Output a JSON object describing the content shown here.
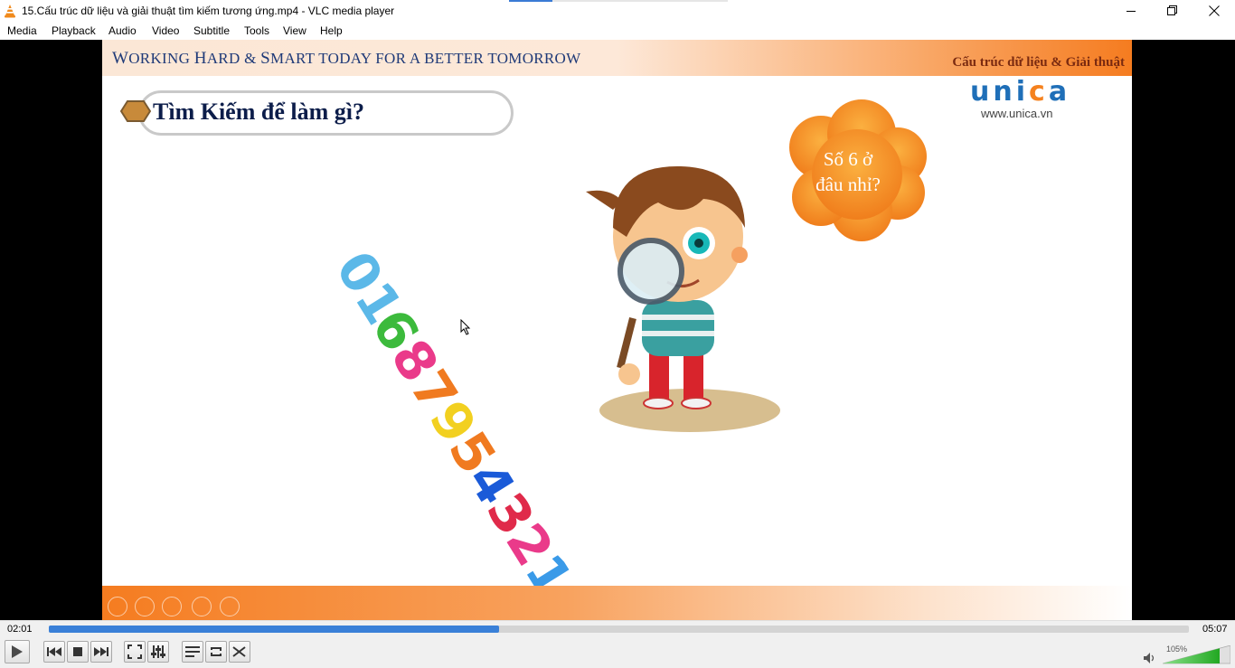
{
  "window": {
    "title": "15.Cấu trúc dữ liệu và giải thuật tìm kiếm tương ứng.mp4 - VLC media player"
  },
  "menu": {
    "media": "Media",
    "playback": "Playback",
    "audio": "Audio",
    "video": "Video",
    "subtitle": "Subtitle",
    "tools": "Tools",
    "view": "View",
    "help": "Help"
  },
  "slide": {
    "header_left_words": [
      "W",
      "ORKING ",
      "H",
      "ARD & ",
      "S",
      "MART TODAY FOR A BETTER TOMORROW"
    ],
    "header_right": "Cấu trúc dữ liệu & Giải thuật",
    "logo": {
      "word": "unica",
      "url": "www.unica.vn"
    },
    "topic_title": "Tìm Kiếm để làm gì?",
    "bubble_lines": [
      "Số 6 ở",
      "đâu nhỉ?"
    ],
    "numbers": [
      "0",
      "1",
      "6",
      "8",
      "7",
      "9",
      "5",
      "4",
      "3",
      "2",
      "1"
    ]
  },
  "player": {
    "elapsed": "02:01",
    "total": "05:07",
    "progress": 0.395,
    "volume_pct": "105%",
    "volume_level": 1.05
  },
  "colors": {
    "accent_blue": "#3a80d8",
    "brand_orange": "#f57c20",
    "header_navy": "#1f3a78"
  },
  "icons": [
    "vlc-cone-icon",
    "minimize-icon",
    "maximize-icon",
    "close-icon",
    "play-icon",
    "previous-icon",
    "stop-icon",
    "next-icon",
    "fullscreen-icon",
    "extended-settings-icon",
    "playlist-icon",
    "loop-icon",
    "shuffle-icon",
    "speaker-icon"
  ]
}
